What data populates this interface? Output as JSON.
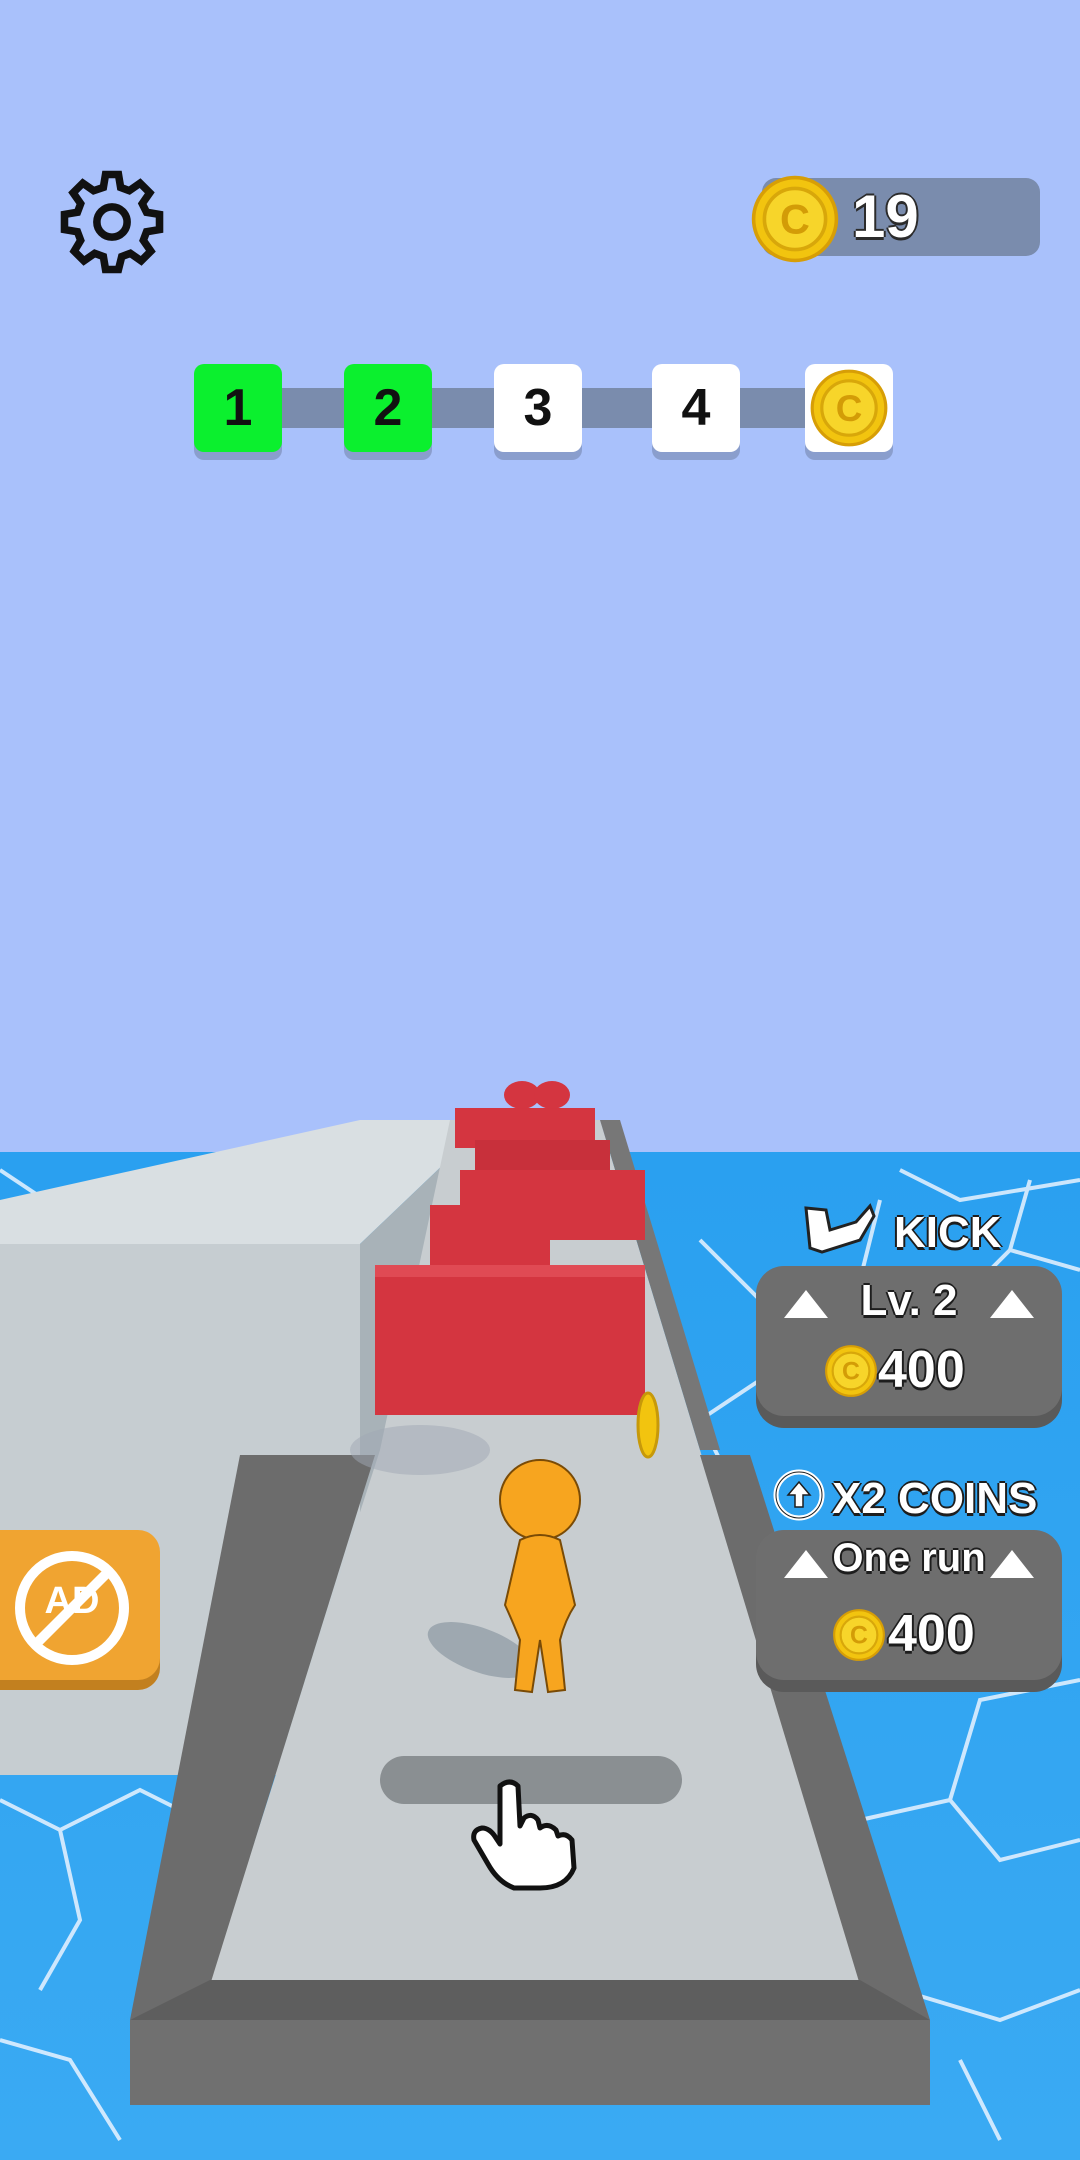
{
  "hud": {
    "coins": "19",
    "settings_icon": "gear-icon",
    "coin_icon": "coin-icon"
  },
  "levels": [
    {
      "label": "1",
      "state": "completed"
    },
    {
      "label": "2",
      "state": "completed"
    },
    {
      "label": "3",
      "state": "locked"
    },
    {
      "label": "4",
      "state": "locked"
    },
    {
      "label": "",
      "state": "reward",
      "icon": "coin-icon"
    }
  ],
  "upgrades": {
    "kick": {
      "title": "KICK",
      "icon": "boot-kick-icon",
      "level": "Lv. 2",
      "price": "400"
    },
    "x2coins": {
      "title": "X2 COINS",
      "icon": "circle-arrow-up-icon",
      "duration": "One run",
      "price": "400"
    }
  },
  "no_ads": {
    "label": "AD",
    "icon": "no-ads-icon"
  },
  "tutorial": {
    "icon": "pointer-hand-icon"
  },
  "colors": {
    "sky": "#a9c1fb",
    "water": "#35a8f2",
    "level_done": "#0bf02e",
    "obstacle": "#d43540",
    "player": "#f7a51f",
    "coin": "#f2c40f",
    "noads": "#f0a431"
  }
}
